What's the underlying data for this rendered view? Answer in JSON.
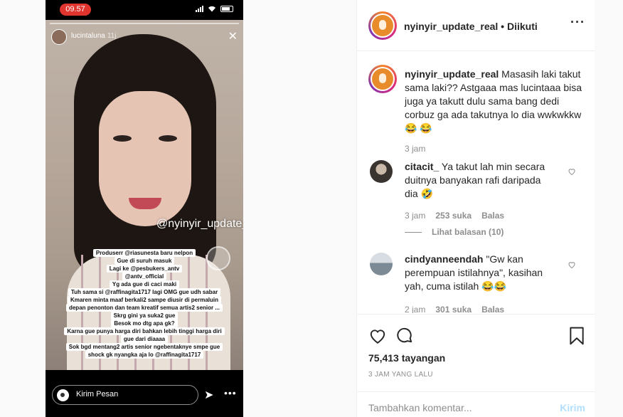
{
  "story": {
    "status_time": "09.57",
    "username": "lucintaluna",
    "posted_ago": "11j",
    "watermark": "@nyinyir_update_real",
    "text_lines": [
      "Produserr @riasunesta baru nelpon",
      "Gue di suruh masuk",
      "Lagi ke @pesbukers_antv",
      "@antv_official",
      "Yg ada gue di caci maki",
      "Tuh sama si @raffinagita1717 lagi OMG gue udh sabar",
      "Kmaren minta maaf berkali2 sampe diusir di permaluin",
      "depan penonton dan team kreatif semua artis2 senior ...",
      "Skrg gini ya suka2 gue",
      "Besok mo dtg apa gk?",
      "Karna gue punya harga diri bahkan lebih tinggi harga diri",
      "gue dari diaaaa",
      "Sok bgd mentang2 artis senior ngebentaknye smpe gue",
      "shock gk nyangka aja lo @raffinagita1717"
    ],
    "message_placeholder": "Kirim Pesan"
  },
  "post": {
    "author": "nyinyir_update_real",
    "dot": "•",
    "follow_status": "Diikuti",
    "caption_text": "Masasih laki takut sama laki?? Astgaaa mas lucintaaa bisa juga ya takutt dulu sama bang dedi corbuz ga ada takutnya lo dia wwkwkkw😂 😂",
    "caption_time": "3 jam"
  },
  "comments": [
    {
      "user": "citacit_",
      "text": "Ya takut lah min secara duitnya banyakan rafi daripada dia 🤣",
      "time": "3 jam",
      "likes": "253 suka",
      "reply": "Balas",
      "view_replies": "Lihat balasan (10)"
    },
    {
      "user": "cindyanneendah",
      "text": "\"Gw kan perempuan istilahnya\", kasihan yah, cuma istilah 😂😂",
      "time": "2 jam",
      "likes": "301 suka",
      "reply": "Balas"
    }
  ],
  "footer": {
    "views": "75,413 tayangan",
    "time_ago": "3 JAM YANG LALU",
    "comment_placeholder": "Tambahkan komentar...",
    "post_label": "Kirim"
  },
  "colors": {
    "link_disabled": "#b2dffc",
    "muted": "#8e8e8e",
    "status_pill": "#e0342f"
  },
  "icons": [
    "heart-icon",
    "comment-icon",
    "bookmark-icon",
    "more-options-icon",
    "camera-icon",
    "send-icon",
    "close-icon"
  ]
}
